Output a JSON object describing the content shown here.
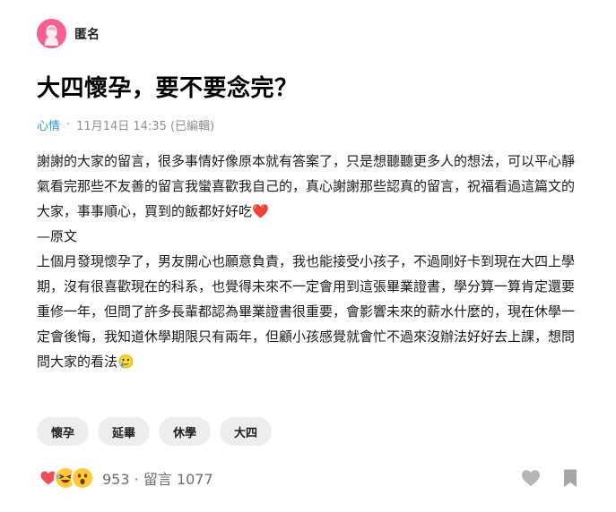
{
  "author": {
    "name": "匿名",
    "avatar_color": "#f75f90"
  },
  "post": {
    "title": "大四懷孕，要不要念完？",
    "forum": "心情",
    "separator": "·",
    "timestamp": "11月14日 14:35 (已編輯)",
    "body": [
      "謝謝的大家的留言，很多事情好像原本就有答案了，只是想聽聽更多人的想法，可以平心靜氣看完那些不友善的留言我蠻喜歡我自己的，真心謝謝那些認真的留言，祝福看過這篇文的大家，事事順心，買到的飯都好好吃❤️",
      "—原文",
      "上個月發現懷孕了，男友開心也願意負責，我也能接受小孩子，不過剛好卡到現在大四上學期，沒有很喜歡現在的科系，也覺得未來不一定會用到這張畢業證書，學分算一算肯定還要重修一年，但問了許多長輩都認為畢業證書很重要，會影響未來的薪水什麼的，現在休學一定會後悔，我知道休學期限只有兩年，但顧小孩感覺就會忙不過來沒辦法好好去上課，想問問大家的看法🥲"
    ]
  },
  "tags": [
    "懷孕",
    "延畢",
    "休學",
    "大四"
  ],
  "footer": {
    "reaction_icons": [
      "heart-reaction-icon",
      "laughing-reaction-icon",
      "surprised-reaction-icon"
    ],
    "like_count": "953",
    "comment_label": "留言",
    "comment_count": "1077",
    "separator": "·"
  },
  "colors": {
    "accent": "#3397cf",
    "heart": "#ef4d5a",
    "emoji_yellow": "#ffc93a",
    "icon_gray": "#b5b5b5",
    "bookmark_gray": "#a6a6a6"
  }
}
